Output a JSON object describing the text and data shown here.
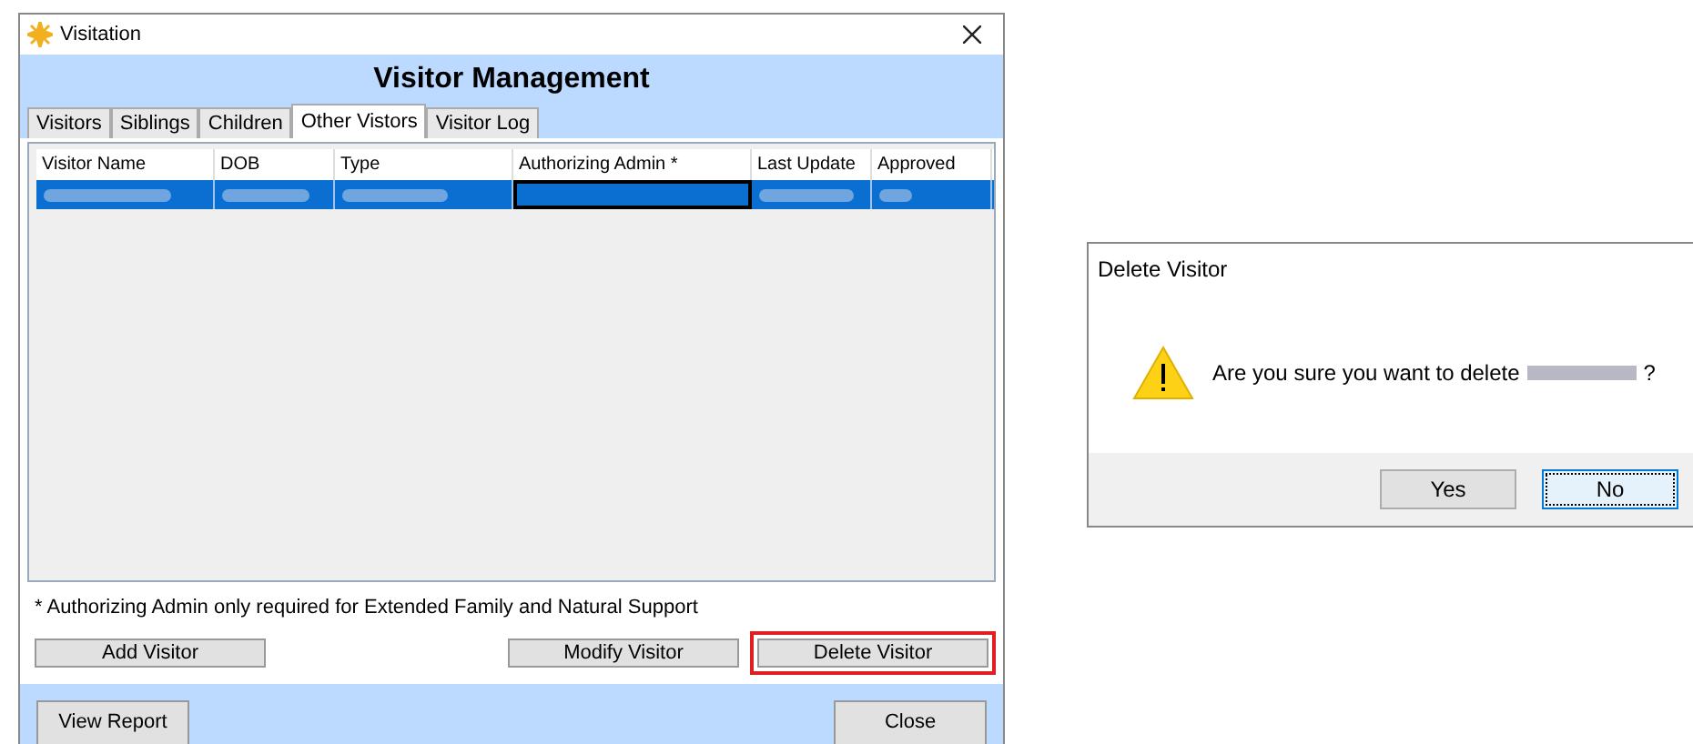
{
  "window": {
    "title": "Visitation",
    "heading": "Visitor Management"
  },
  "tabs": [
    {
      "label": "Visitors",
      "selected": false
    },
    {
      "label": "Siblings",
      "selected": false
    },
    {
      "label": "Children",
      "selected": false
    },
    {
      "label": "Other Vistors",
      "selected": true
    },
    {
      "label": "Visitor Log",
      "selected": false
    }
  ],
  "table": {
    "columns": [
      "Visitor Name",
      "DOB",
      "Type",
      "Authorizing Admin *",
      "Last Update",
      "Approved"
    ],
    "rows": [
      {
        "selected": true,
        "cells": [
          {
            "kind": "blurred",
            "focused": false
          },
          {
            "kind": "blurred",
            "focused": false
          },
          {
            "kind": "blurred",
            "focused": false
          },
          {
            "kind": "empty",
            "focused": true
          },
          {
            "kind": "blurred",
            "focused": false
          },
          {
            "kind": "blurred",
            "focused": false
          }
        ]
      }
    ]
  },
  "footnote": "* Authorizing Admin only required for Extended Family and Natural Support",
  "row_buttons": [
    {
      "label": "Add Visitor",
      "highlighted": false
    },
    {
      "label": "Modify Visitor",
      "highlighted": false
    },
    {
      "label": "Delete Visitor",
      "highlighted": true
    }
  ],
  "footer_buttons": [
    "View Report",
    "Close"
  ],
  "dialog": {
    "title": "Delete Visitor",
    "message": "Are you sure you want to delete",
    "message_end": "?",
    "buttons": [
      {
        "label": "Yes",
        "default": false
      },
      {
        "label": "No",
        "default": true
      }
    ]
  }
}
